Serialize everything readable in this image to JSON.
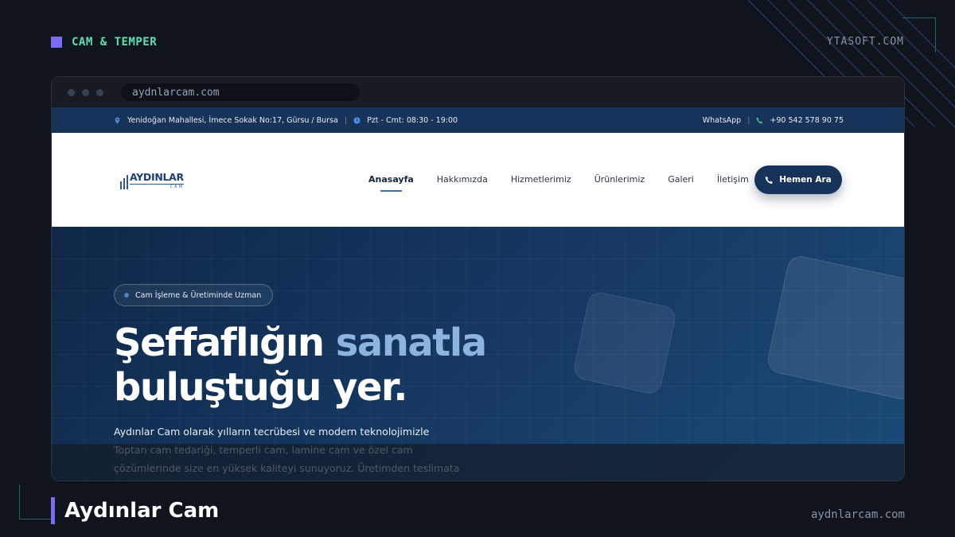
{
  "slide": {
    "category": "CAM & TEMPER",
    "brand": "YTASOFT.COM",
    "project_title": "Aydınlar Cam",
    "project_url": "aydnlarcam.com",
    "accent_color": "#7b6cf6",
    "tag_color": "#5ee0b0"
  },
  "browser": {
    "url": "aydnlarcam.com"
  },
  "site": {
    "infobar": {
      "address": "Yenidoğan Mahallesi, İmece Sokak No:17, Gürsu / Bursa",
      "hours": "Pzt - Cmt: 08:30 - 19:00",
      "whatsapp": "WhatsApp",
      "phone": "+90 542 578 90 75",
      "address_icon": "map-pin-icon",
      "hours_icon": "clock-icon",
      "phone_icon": "phone-icon"
    },
    "logo": {
      "main": "AYDINLAR",
      "sub": "CAM"
    },
    "nav": [
      {
        "label": "Anasayfa",
        "active": true
      },
      {
        "label": "Hakkımızda"
      },
      {
        "label": "Hizmetlerimiz"
      },
      {
        "label": "Ürünlerimiz"
      },
      {
        "label": "Galeri"
      },
      {
        "label": "İletişim"
      }
    ],
    "cta": {
      "label": "Hemen Ara",
      "icon": "phone-icon",
      "color": "#17335a"
    },
    "hero": {
      "badge": "Cam İşleme & Üretiminde Uzman",
      "headline_part1": "Şeffaflığın ",
      "headline_accent": "sanatla",
      "headline_line2": "buluştuğu yer.",
      "paragraph": "Aydınlar Cam olarak yılların tecrübesi ve modern teknolojimizle Toptan cam tedariği, temperli cam, lamine cam ve özel cam çözümlerinde size en yüksek kaliteyi sunuyoruz. Üretimden teslimata"
    }
  }
}
